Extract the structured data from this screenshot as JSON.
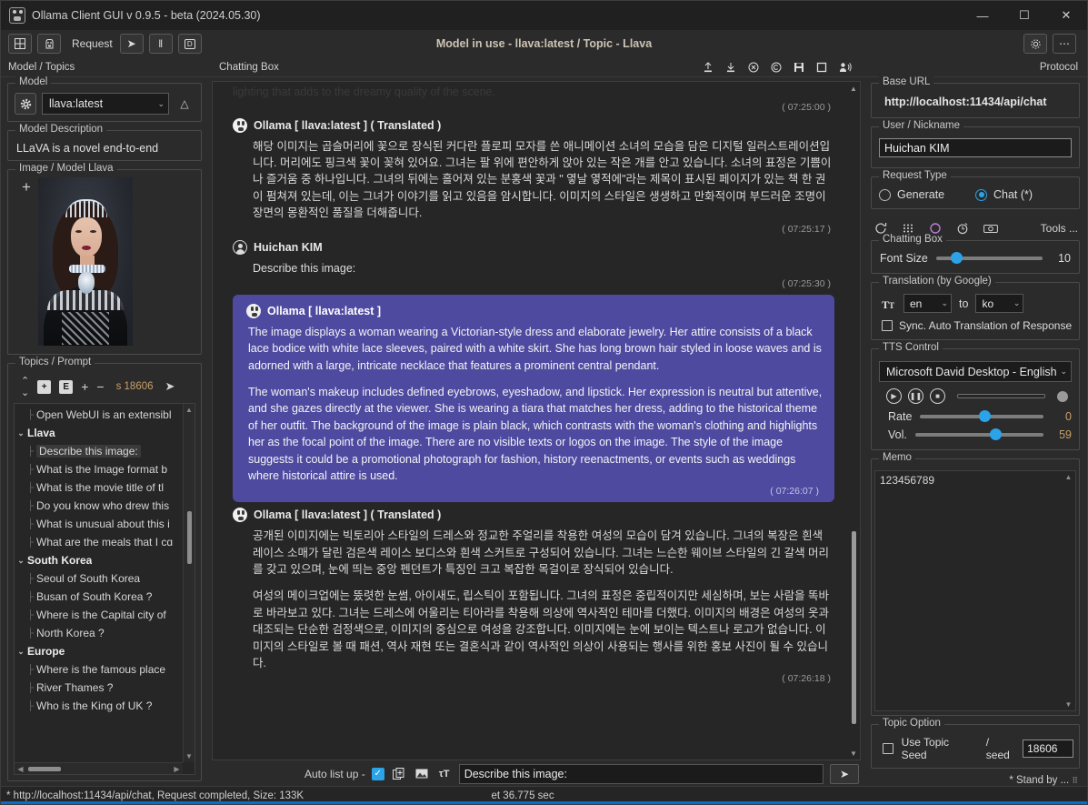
{
  "window": {
    "title": "Ollama Client GUI v 0.9.5 - beta (2024.05.30)",
    "app_icon": "llama-icon",
    "minimize": "—",
    "maximize": "☐",
    "close": "✕"
  },
  "toolbar": {
    "grid_button": "grid-icon",
    "llama_button": "llama-icon",
    "request_label": "Request",
    "send_button": "➤",
    "pause_button": "‖",
    "d_button": "D",
    "center_title": "Model in use - llava:latest / Topic - Llava",
    "settings_button": "gear-icon",
    "more_button": "⋯"
  },
  "panel_captions": {
    "left": "Model / Topics",
    "center": "Chatting Box",
    "right": "Protocol"
  },
  "chat_toolbar_icons": [
    "upload-icon",
    "download-icon",
    "clear-icon",
    "copy-icon",
    "save-icon",
    "stop-icon",
    "speak-icon"
  ],
  "left_panel": {
    "model_group": {
      "caption": "Model",
      "gear_icon": "gear-icon",
      "selected": "llava:latest",
      "chevron": "⌄",
      "up_button": "△"
    },
    "model_description": {
      "caption": "Model Description",
      "text": "LLaVA is a novel end-to-end"
    },
    "image_group": {
      "caption": "Image / Model Llava",
      "add_button": "+",
      "thumbnail_alt": "victorian-woman-portrait"
    },
    "topics_group": {
      "caption": "Topics / Prompt",
      "sort_button": "sort-icon",
      "add_folder_button": "+",
      "edit_button": "E",
      "plus_button": "+",
      "minus_button": "−",
      "seed_label": "s 18606",
      "run_button": "➤",
      "tree": [
        {
          "type": "item",
          "label": "Open WebUI is an extensibl",
          "selected": false
        },
        {
          "type": "group",
          "label": "Llava",
          "twist": "⌄"
        },
        {
          "type": "item",
          "label": "Describe this image:",
          "selected": true
        },
        {
          "type": "item",
          "label": "What is the Image format b",
          "selected": false
        },
        {
          "type": "item",
          "label": "What is the movie title of  tl",
          "selected": false
        },
        {
          "type": "item",
          "label": "Do you know who drew this",
          "selected": false
        },
        {
          "type": "item",
          "label": "What is unusual about this i",
          "selected": false
        },
        {
          "type": "item",
          "label": "What are the meals that I cɑ",
          "selected": false
        },
        {
          "type": "group",
          "label": "South Korea",
          "twist": "⌄"
        },
        {
          "type": "item",
          "label": "Seoul of South Korea",
          "selected": false
        },
        {
          "type": "item",
          "label": "Busan of South Korea ?",
          "selected": false
        },
        {
          "type": "item",
          "label": "Where is the Capital city of",
          "selected": false
        },
        {
          "type": "item",
          "label": "North Korea ?",
          "selected": false
        },
        {
          "type": "group",
          "label": "Europe",
          "twist": "⌄"
        },
        {
          "type": "item",
          "label": "Where is the famous place",
          "selected": false
        },
        {
          "type": "item",
          "label": "River Thames ?",
          "selected": false
        },
        {
          "type": "item",
          "label": "Who is the King of UK ?",
          "selected": false
        }
      ]
    }
  },
  "chat": {
    "cut_off_line": "lighting that adds to the dreamy quality of the scene.",
    "messages": [
      {
        "id": "m0",
        "kind": "cutoff",
        "timestamp": "( 07:25:00 )"
      },
      {
        "id": "m1",
        "kind": "assistant",
        "avatar": "llama-avatar-icon",
        "sender": "Ollama [ llava:latest ]  ( Translated )",
        "paragraphs": [
          "해당 이미지는 곱슬머리에 꽃으로 장식된 커다란 플로피 모자를 쓴 애니메이션 소녀의 모습을 담은 디지털 일러스트레이션입니다. 머리에도 핑크색 꽃이 꽂혀 있어요. 그녀는 팔 위에 편안하게 앉아 있는 작은 개를 안고 있습니다. 소녀의 표정은 기쁨이나 즐거움 중 하나입니다. 그녀의 뒤에는 흘어져 있는 분홍색 꽃과 \" 옇날 옇적에\"라는 제목이 표시된 페이지가 있는 책 한 권이 펌쳐져 있는데, 이는 그녀가 이야기를 읽고 있음을 암시합니다. 이미지의 스타일은 생생하고 만화적이며 부드러운 조명이 장면의 몽환적인 품질을 더해줍니다."
        ],
        "timestamp": "( 07:25:17 )"
      },
      {
        "id": "m2",
        "kind": "user",
        "avatar": "user-avatar-icon",
        "sender": "Huichan KIM",
        "paragraphs": [
          "Describe this image:"
        ],
        "timestamp": "( 07:25:30 )"
      },
      {
        "id": "m3",
        "kind": "assistant-highlight",
        "avatar": "llama-avatar-icon",
        "sender": "Ollama [ llava:latest ]",
        "paragraphs": [
          "The image displays a woman wearing a Victorian-style dress and elaborate jewelry. Her attire consists of a black lace bodice with white lace sleeves, paired with a white skirt. She has long brown hair styled in loose waves and is adorned with a large, intricate necklace that features a prominent central pendant.",
          "The woman's makeup includes defined eyebrows, eyeshadow, and lipstick. Her expression is neutral but attentive, and she gazes directly at the viewer. She is wearing a tiara that matches her dress, adding to the historical theme of her outfit. The background of the image is plain black, which contrasts with the woman's clothing and highlights her as the focal point of the image. There are no visible texts or logos on the image. The style of the image suggests it could be a promotional photograph for fashion, history reenactments, or events such as weddings where historical attire is used."
        ],
        "timestamp": "( 07:26:07 )"
      },
      {
        "id": "m4",
        "kind": "assistant",
        "avatar": "llama-avatar-icon",
        "sender": "Ollama [ llava:latest ]  ( Translated )",
        "paragraphs": [
          "공개된 이미지에는 빅토리아 스타일의 드레스와 정교한 주얼리를 착용한 여성의 모습이 담겨 있습니다. 그녀의 복장은 흰색 레이스 소매가 달린 검은색 레이스 보디스와 흰색 스커트로 구성되어 있습니다. 그녀는 느슨한 웨이브 스타일의 긴 갈색 머리를 갖고 있으며, 눈에 띄는 중앙 펜던트가 특징인 크고 복잡한 목걸이로 장식되어 있습니다.",
          "여성의 메이크업에는 뚰렷한 눈썸, 아이새도, 립스틱이 포함됩니다. 그녀의 표정은 중립적이지만 세심하며, 보는 사람을 똑바로 바라보고 있다. 그녀는 드레스에 어울리는 티아라를 착용해 의상에 역사적인 테마를 더했다. 이미지의 배경은 여성의 옷과 대조되는 단순한 검정색으로, 이미지의 중심으로 여성을 강조합니다. 이미지에는 눈에 보이는 텍스트나 로고가 없습니다. 이미지의 스타일로 볼 때 패션, 역사 재현 또는 결혼식과 같이 역사적인 의상이 사용되는 행사를 위한 홍보 사진이 될 수 있습니다."
        ],
        "timestamp": "( 07:26:18 )"
      }
    ]
  },
  "input_row": {
    "auto_list_label": "Auto list up  -",
    "auto_list_checked": true,
    "copy_icon": "add-file-icon",
    "image_icon": "image-icon",
    "font_icon": "font-size-icon",
    "prompt_value": "Describe this image:",
    "prompt_placeholder": "",
    "send_label": "➤"
  },
  "right_panel": {
    "base_url": {
      "caption": "Base URL",
      "value": "http://localhost:11434/api/chat"
    },
    "user": {
      "caption": "User / Nickname",
      "value": "Huichan KIM"
    },
    "request_type": {
      "caption": "Request Type",
      "options": [
        {
          "label": "Generate",
          "selected": false
        },
        {
          "label": "Chat (*)",
          "selected": true
        }
      ]
    },
    "tools_row": {
      "icons": [
        "refresh-icon",
        "grid-icon",
        "circle-icon",
        "timer-icon",
        "camera-icon"
      ],
      "label": "Tools ..."
    },
    "chatting_box": {
      "caption": "Chatting Box",
      "font_size_label": "Font Size",
      "font_size_value": "10"
    },
    "translation": {
      "caption": "Translation (by Google)",
      "icon": "translate-icon",
      "from": "en",
      "to_label": "to",
      "to": "ko",
      "sync_label": "Sync. Auto Translation of Response",
      "sync_checked": false
    },
    "tts": {
      "caption": "TTS Control",
      "voice": "Microsoft David Desktop - English",
      "play_icon": "play-icon",
      "pause_icon": "pause-icon",
      "stop_icon": "stop-icon",
      "settings_icon": "gear-icon",
      "rate_label": "Rate",
      "rate_value": "0",
      "vol_label": "Vol.",
      "vol_value": "59"
    },
    "memo": {
      "caption": "Memo",
      "value": "123456789"
    },
    "topic_option": {
      "caption": "Topic Option",
      "use_seed_label": "Use Topic Seed",
      "use_seed_checked": false,
      "seed_label": "/ seed",
      "seed_value": "18606"
    },
    "standby": "* Stand by ..."
  },
  "status_bar": {
    "left": "* http://localhost:11434/api/chat, Request completed, Size: 133K",
    "elapsed": "et 36.775 sec"
  },
  "colors": {
    "accent_blue": "#0b6ccd",
    "bubble_purple": "#4e4aa0",
    "slider_blue": "#2aa3e8",
    "seed_orange": "#c8a06a",
    "window_bg": "#2b2b2b"
  }
}
